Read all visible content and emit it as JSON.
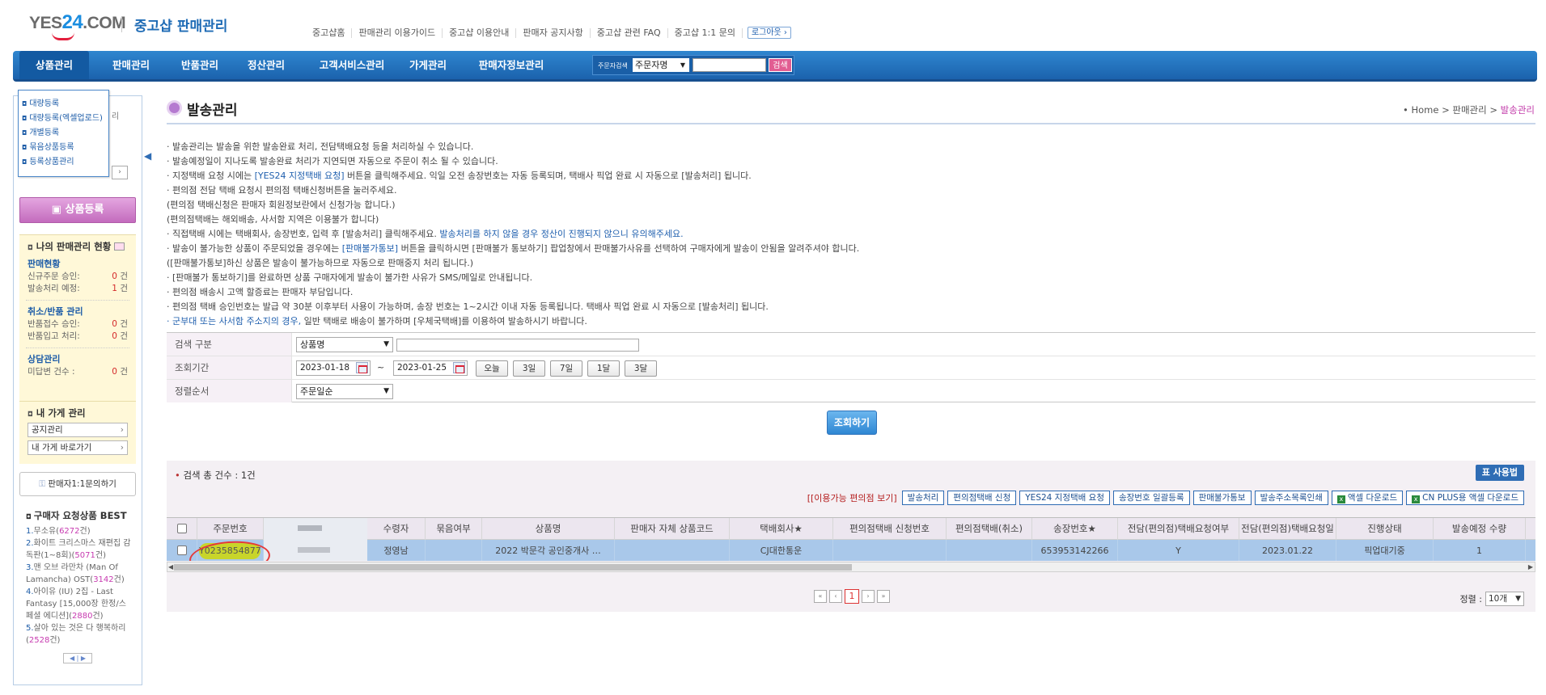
{
  "header": {
    "logo_yes": "YES",
    "logo_24": "24",
    "logo_com": ".COM",
    "site_title": "중고샵 판매관리",
    "links": [
      "중고샵홈",
      "판매관리 이용가이드",
      "중고샵 이용안내",
      "판매자 공지사항",
      "중고샵 관련 FAQ",
      "중고샵 1:1 문의"
    ],
    "logout": "로그아웃 ›"
  },
  "nav": {
    "items": [
      "상품관리",
      "판매관리",
      "반품관리",
      "정산관리",
      "고객서비스관리",
      "가게관리",
      "판매자정보관리"
    ],
    "search_label": "주문자검색",
    "search_select": "주문자명",
    "search_button": "검색"
  },
  "sidebar": {
    "dropdown": [
      "대량등록",
      "대량등록(엑셀업로드)",
      "개별등록",
      "묶음상품등록",
      "등록상품관리"
    ],
    "hidden_text": "리",
    "register_button": "상품등록",
    "status_title": "나의 판매관리 현황",
    "sales_link": "판매현황",
    "new_order_label": "신규주문 승인:",
    "new_order_value": "0",
    "ship_due_label": "발송처리 예정:",
    "ship_due_value": "1",
    "unit": "건",
    "cancel_link": "취소/반품 관리",
    "return_accept_label": "반품접수 승인:",
    "return_accept_value": "0",
    "return_in_label": "반품입고 처리:",
    "return_in_value": "0",
    "counsel_link": "상담관리",
    "unanswered_label": "미답변 건수 :",
    "unanswered_value": "0",
    "shop_title": "내 가게 관리",
    "notice_btn": "공지관리",
    "shop_btn": "내 가게 바로가기",
    "qa_btn": "판매자1:1문의하기",
    "best_title": "구매자 요청상품 BEST",
    "best_items": [
      {
        "n": "1.",
        "t": "무소유(",
        "c": "6272",
        "e": "건)"
      },
      {
        "n": "2.",
        "t": "화이트 크리스마스 재편집 감독판(1~8회)(",
        "c": "5071",
        "e": "건)"
      },
      {
        "n": "3.",
        "t": "맨 오브 라만차 (Man Of Lamancha) OST(",
        "c": "3142",
        "e": "건)"
      },
      {
        "n": "4.",
        "t": "아이유 (IU) 2집 - Last Fantasy [15,000장 한정/스페셜 에디션](",
        "c": "2880",
        "e": "건)"
      },
      {
        "n": "5.",
        "t": "살아 있는 것은 다 행복하리(",
        "c": "2528",
        "e": "건)"
      }
    ]
  },
  "page": {
    "title": "발송관리",
    "breadcrumb_home": "• Home",
    "breadcrumb_mid": "판매관리",
    "breadcrumb_cur": "발송관리",
    "guide": [
      [
        "· 발송관리는 발송을 위한 발송완료 처리, 전담택배요청 등을 처리하실 수 있습니다.",
        "",
        ""
      ],
      [
        "· 발송예정일이 지나도록 발송완료 처리가 지연되면 자동으로 주문이 취소 될 수 있습니다.",
        "",
        ""
      ],
      [
        "· 지정택배 요청 시에는 ",
        "[YES24 지정택배 요청]",
        " 버튼을 클릭해주세요. 익일 오전 송장번호는 자동 등록되며, 택배사 픽업 완료 시 자동으로 [발송처리] 됩니다."
      ],
      [
        "· 편의점 전담 택배 요청시 편의점 택배신청버튼을 눌러주세요.",
        "",
        ""
      ],
      [
        "  (편의점 택배신청은 판매자 회원정보란에서 신청가능 합니다.)",
        "",
        ""
      ],
      [
        "  (편의점택배는 해외배송, 사서함 지역은 이용불가 합니다)",
        "",
        ""
      ],
      [
        "· 직접택배 시에는 택배회사, 송장번호, 입력 후 [발송처리] 클릭해주세요. ",
        "발송처리를 하지 않을 경우 정산이 진행되지 않으니 유의해주세요.",
        ""
      ],
      [
        "· 발송이 불가능한 상품이 주문되었을 경우에는 ",
        "[판매불가통보]",
        " 버튼을 클릭하시면 [판매불가 통보하기] 팝업창에서 판매불가사유를 선택하여 구매자에게 발송이 안됨을 알려주셔야 합니다."
      ],
      [
        "  ([판매불가통보]하신 상품은 발송이 불가능하므로 자동으로 판매중지 처리 됩니다.)",
        "",
        ""
      ],
      [
        "· [판매불가 통보하기]를 완료하면 상품 구매자에게 발송이 불가한 사유가 SMS/메일로 안내됩니다.",
        "",
        ""
      ],
      [
        "· 편의점 배송시 고액 할증료는 판매자 부담입니다.",
        "",
        ""
      ],
      [
        "· 편의점 택배 승인번호는 발급 약 30분 이후부터 사용이 가능하며, 송장 번호는 1~2시간 이내 자동 등록됩니다. 택배사 픽업 완료 시 자동으로 [발송처리] 됩니다.",
        "",
        ""
      ],
      [
        "",
        "· 군부대 또는 사서함 주소지의 경우,",
        " 일반 택배로 배송이 불가하며 [우체국택배]를 이용하여 발송하시기 바랍니다."
      ]
    ]
  },
  "form": {
    "search_type_label": "검색 구분",
    "search_type_value": "상품명",
    "period_label": "조회기간",
    "date_from": "2023-01-18",
    "date_sep": "~",
    "date_to": "2023-01-25",
    "period_buttons": [
      "오늘",
      "3일",
      "7일",
      "1달",
      "3달"
    ],
    "order_label": "정렬순서",
    "order_value": "주문일순",
    "search_button": "조회하기"
  },
  "results": {
    "count_text": "검색 총 건수 : 1건",
    "table_setting": "표 사용법",
    "link_text": "[[이용가능 편의점 보기]",
    "actions": [
      "발송처리",
      "편의점택배 신청",
      "YES24 지정택배 요청",
      "송장번호 일괄등록",
      "판매불가통보",
      "발송주소목록인쇄",
      "액셀 다운로드",
      "CN PLUS용 액셀 다운로드"
    ],
    "columns": [
      "주문번호",
      "수령자",
      "묶음여부",
      "상품명",
      "판매자 자체 상품코드",
      "택배회사★",
      "편의점택배 신청번호",
      "편의점택배(취소)",
      "송장번호★",
      "전담(편의점)택배요청여부",
      "전담(편의점)택배요청일",
      "진행상태",
      "발송예정 수량"
    ],
    "row": [
      "Y0235854877",
      "정영남",
      "",
      "2022 박문각 공인중개사 …",
      "",
      "CJ대한통운",
      "",
      "",
      "653953142266",
      "Y",
      "2023.01.22",
      "픽업대기중",
      "1"
    ],
    "page": "1",
    "sort_label": "정렬 :",
    "sort_value": "10개"
  }
}
